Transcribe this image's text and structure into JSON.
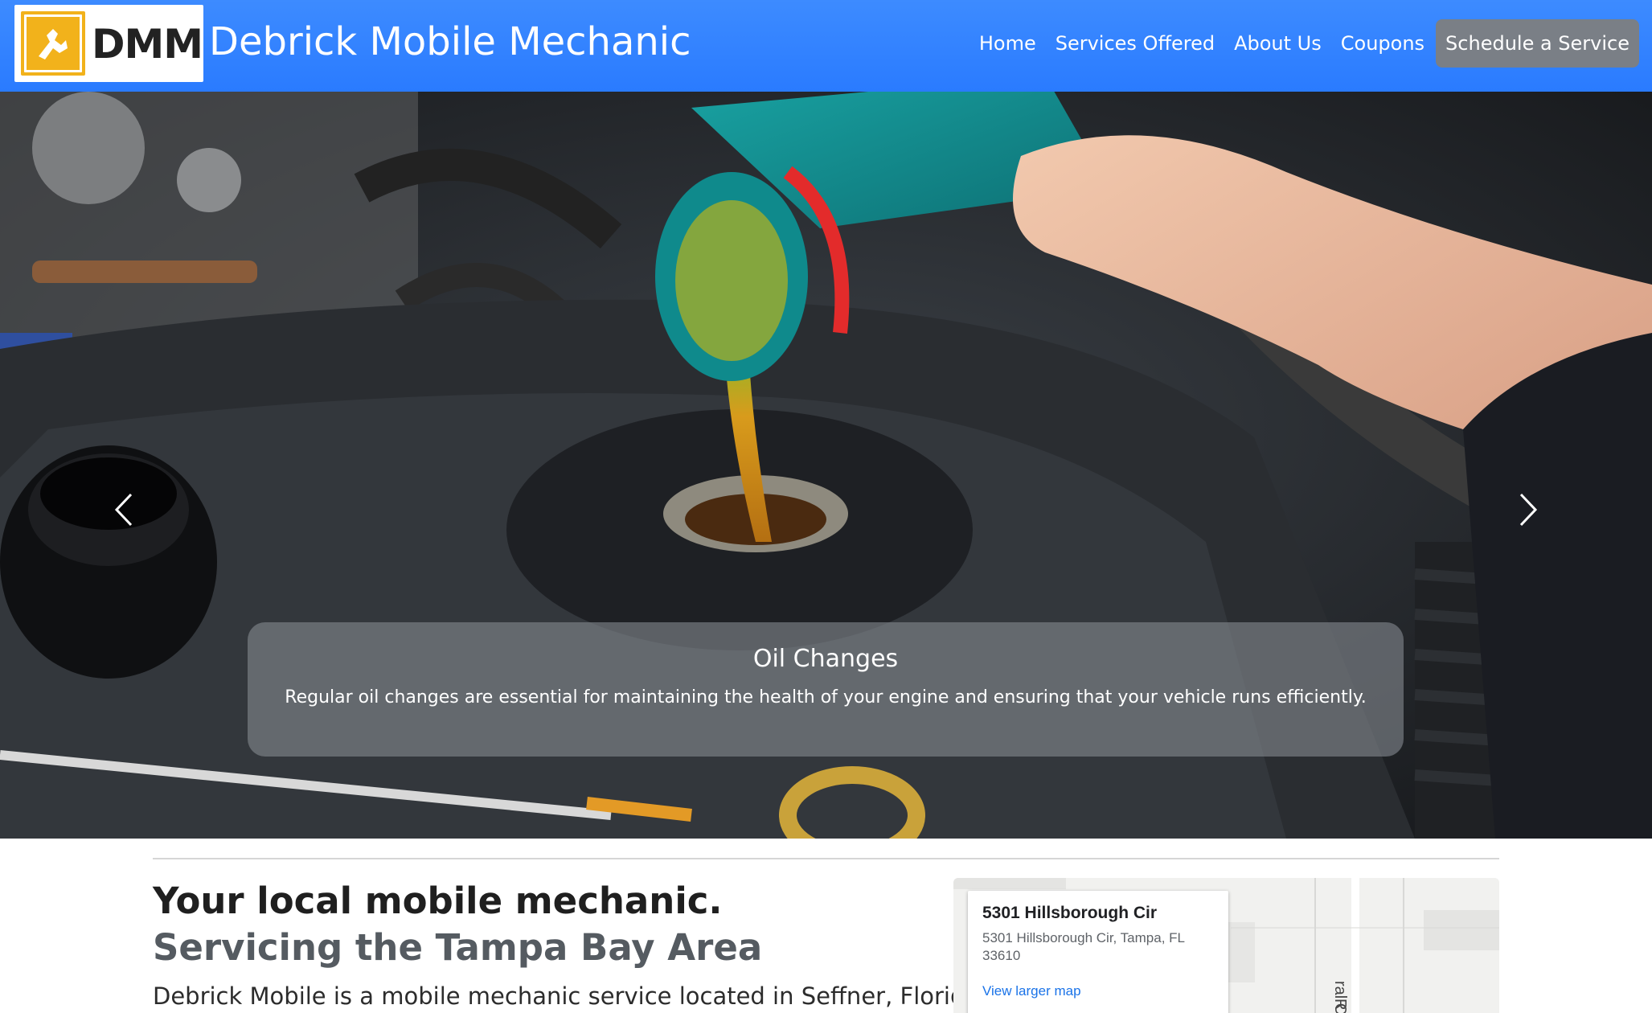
{
  "nav": {
    "logo_text": "DMM",
    "brand_title": "Debrick Mobile Mechanic",
    "links": [
      "Home",
      "Services Offered",
      "About Us",
      "Coupons"
    ],
    "cta": "Schedule a Service"
  },
  "hero": {
    "caption_title": "Oil Changes",
    "caption_text": "Regular oil changes are essential for maintaining the health of your engine and ensuring that your vehicle runs efficiently."
  },
  "intro": {
    "headline_strong": "Your local mobile mechanic.",
    "headline_muted": "Servicing the Tampa Bay Area",
    "lead": "Debrick Mobile is a mobile mechanic service located in Seffner, Florida"
  },
  "map": {
    "card_title": "5301 Hillsborough Cir",
    "card_address": "5301 Hillsborough Cir, Tampa, FL 33610",
    "card_link": "View larger map",
    "street_label": "ral Oak Dr",
    "street_label_2": "R"
  },
  "colors": {
    "navbar": "#3d8bff",
    "cta_bg": "#7a7f86",
    "logo_accent": "#f2b21b",
    "map_link": "#1a73e8"
  }
}
